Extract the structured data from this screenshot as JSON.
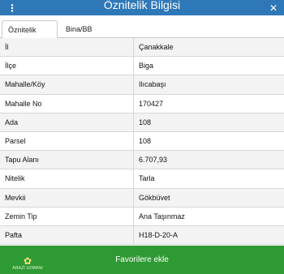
{
  "header": {
    "title": "Öznitelik Bilgisi",
    "menu_icon": "vertical-dots-icon",
    "close_icon": "close-icon"
  },
  "tabs": [
    {
      "label": "Öznitelik Bilgisi",
      "active": true
    },
    {
      "label": "Bina/BB Listesi",
      "active": false
    }
  ],
  "attributes": [
    {
      "key": "İl",
      "value": "Çanakkale"
    },
    {
      "key": "İlçe",
      "value": "Biga"
    },
    {
      "key": "Mahalle/Köy",
      "value": "Ilıcabaşı"
    },
    {
      "key": "Mahalle No",
      "value": "170427"
    },
    {
      "key": "Ada",
      "value": "108"
    },
    {
      "key": "Parsel",
      "value": "108"
    },
    {
      "key": "Tapu Alanı",
      "value": "6.707,93"
    },
    {
      "key": "Nitelik",
      "value": "Tarla"
    },
    {
      "key": "Mevkii",
      "value": "Gökbüvet"
    },
    {
      "key": "Zemin Tip",
      "value": "Ana Taşınmaz"
    },
    {
      "key": "Pafta",
      "value": "H18-D-20-A"
    }
  ],
  "footer": {
    "button_label": "Favorilere ekle",
    "logo_text": "ARAZİ UZMANI"
  },
  "colors": {
    "header_bg": "#2f78b8",
    "footer_bg": "#2e9a33"
  }
}
